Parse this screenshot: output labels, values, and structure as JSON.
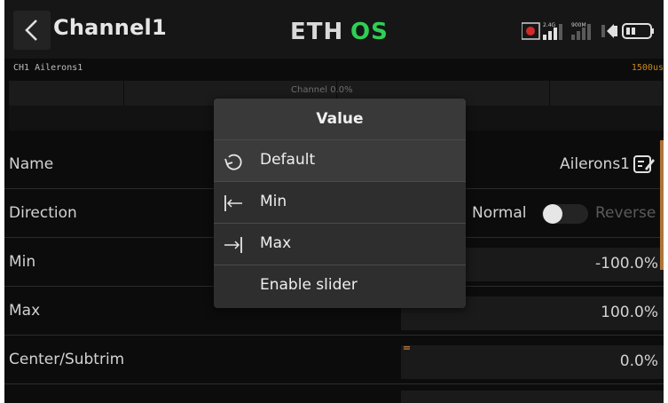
{
  "header": {
    "title": "Channel1",
    "logo_text_left": "ETH",
    "logo_text_right": "OS",
    "logo_color_left": "#d9d9d9",
    "logo_color_right": "#2fcf55",
    "band_label": "2.4G",
    "rx_label": "900M"
  },
  "channel_bar": {
    "label": "CH1  Ailerons1",
    "value": "1500us",
    "bar_text": "Channel  0.0%"
  },
  "rows": [
    {
      "label": "Name",
      "value": "Ailerons1"
    },
    {
      "label": "Direction",
      "value_left": "Normal",
      "value_right": "Reverse"
    },
    {
      "label": "Min",
      "value": "-100.0%"
    },
    {
      "label": "Max",
      "value": "100.0%"
    },
    {
      "label": "Center/Subtrim",
      "value": "0.0%"
    }
  ],
  "popup": {
    "title": "Value",
    "items": [
      {
        "label": "Default",
        "icon": "reset-icon"
      },
      {
        "label": "Min",
        "icon": "min-arrow-icon"
      },
      {
        "label": "Max",
        "icon": "max-arrow-icon"
      },
      {
        "label": "Enable slider",
        "icon": ""
      }
    ]
  },
  "colors": {
    "accent": "#b0743a",
    "channel_value": "#c58a1c",
    "background": "#0c0c0c",
    "popup_bg": "#2e2e2e"
  }
}
